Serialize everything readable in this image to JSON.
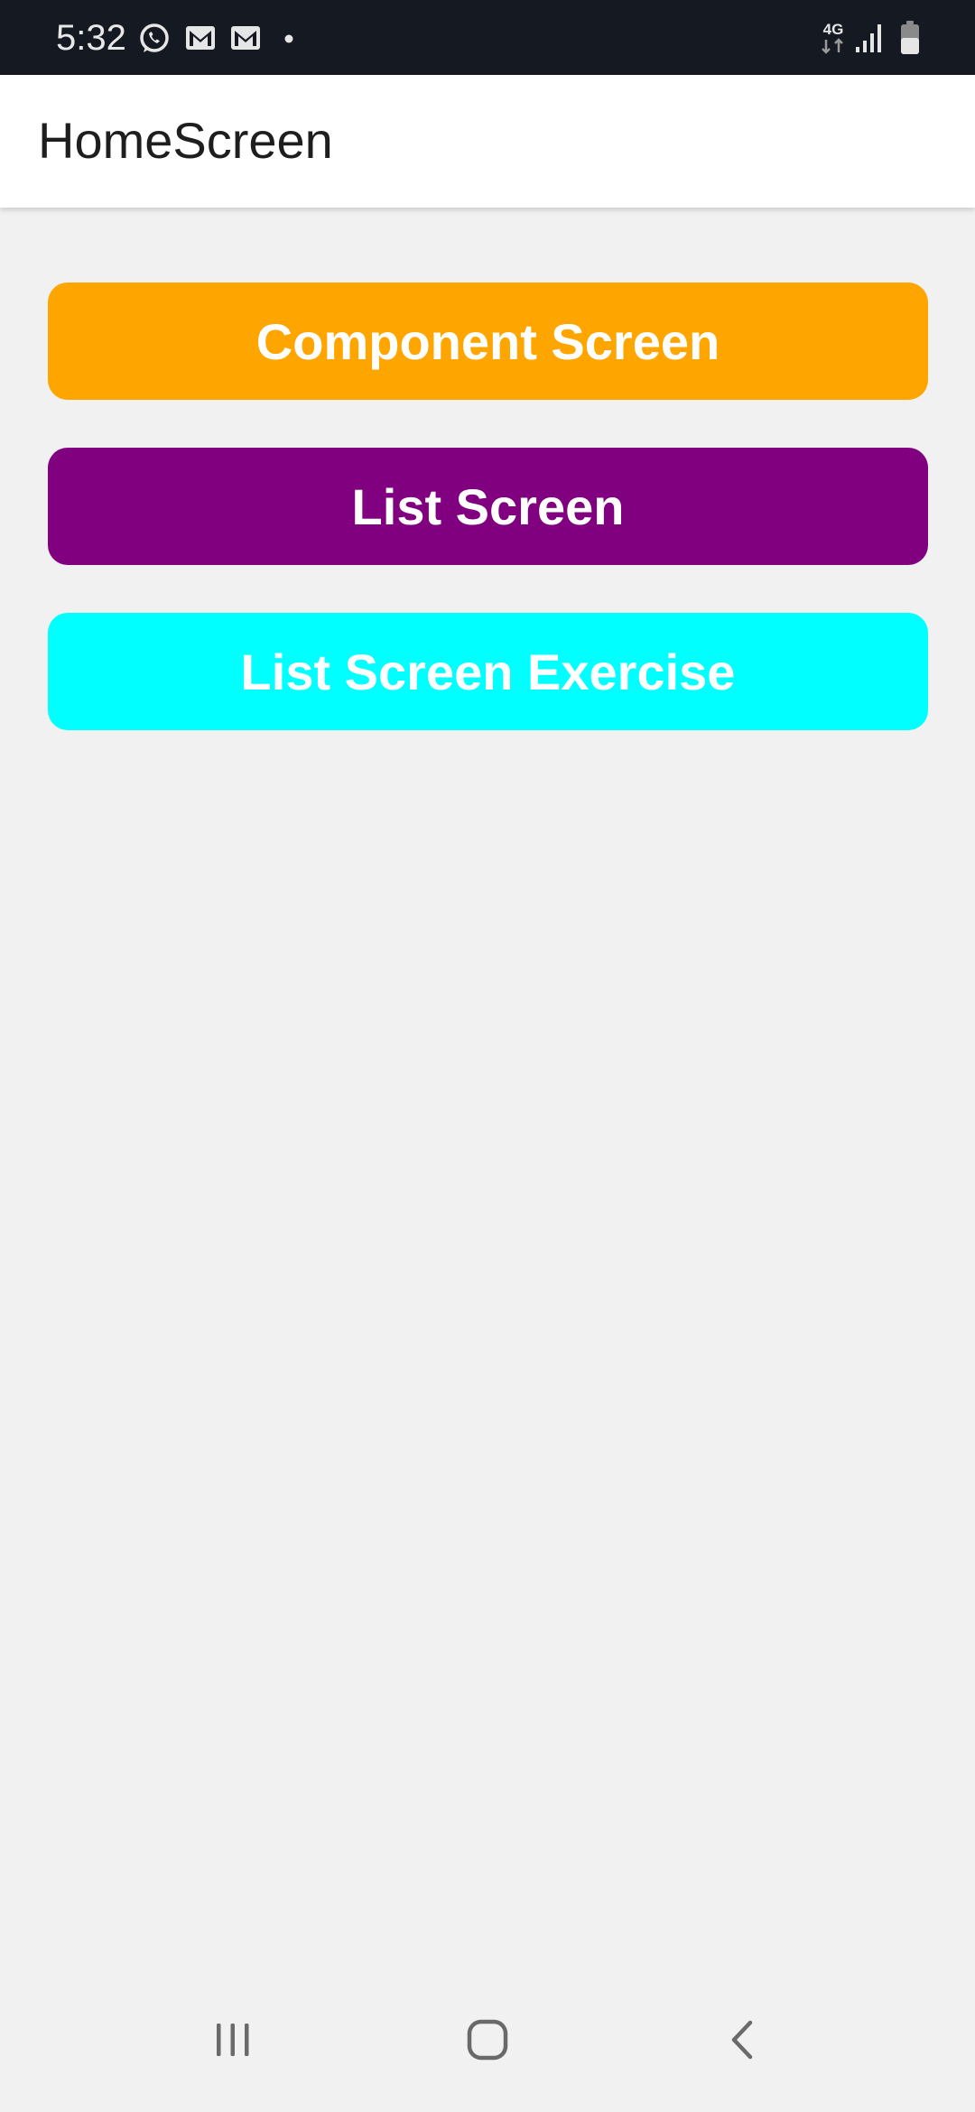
{
  "status_bar": {
    "time": "5:32",
    "network_type": "4G",
    "background_color": "#151a22",
    "icons": [
      "whatsapp-icon",
      "gmail-icon",
      "gmail-icon",
      "notification-dot-icon",
      "network-4g-icon",
      "signal-icon",
      "battery-icon"
    ]
  },
  "app_bar": {
    "title": "HomeScreen"
  },
  "buttons": [
    {
      "label": "Component Screen",
      "color": "#ffa500"
    },
    {
      "label": "List Screen",
      "color": "#800080"
    },
    {
      "label": "List Screen Exercise",
      "color": "#00ffff"
    }
  ],
  "navigation_bar": {
    "icons": [
      "recent-apps-icon",
      "home-icon",
      "back-icon"
    ]
  }
}
